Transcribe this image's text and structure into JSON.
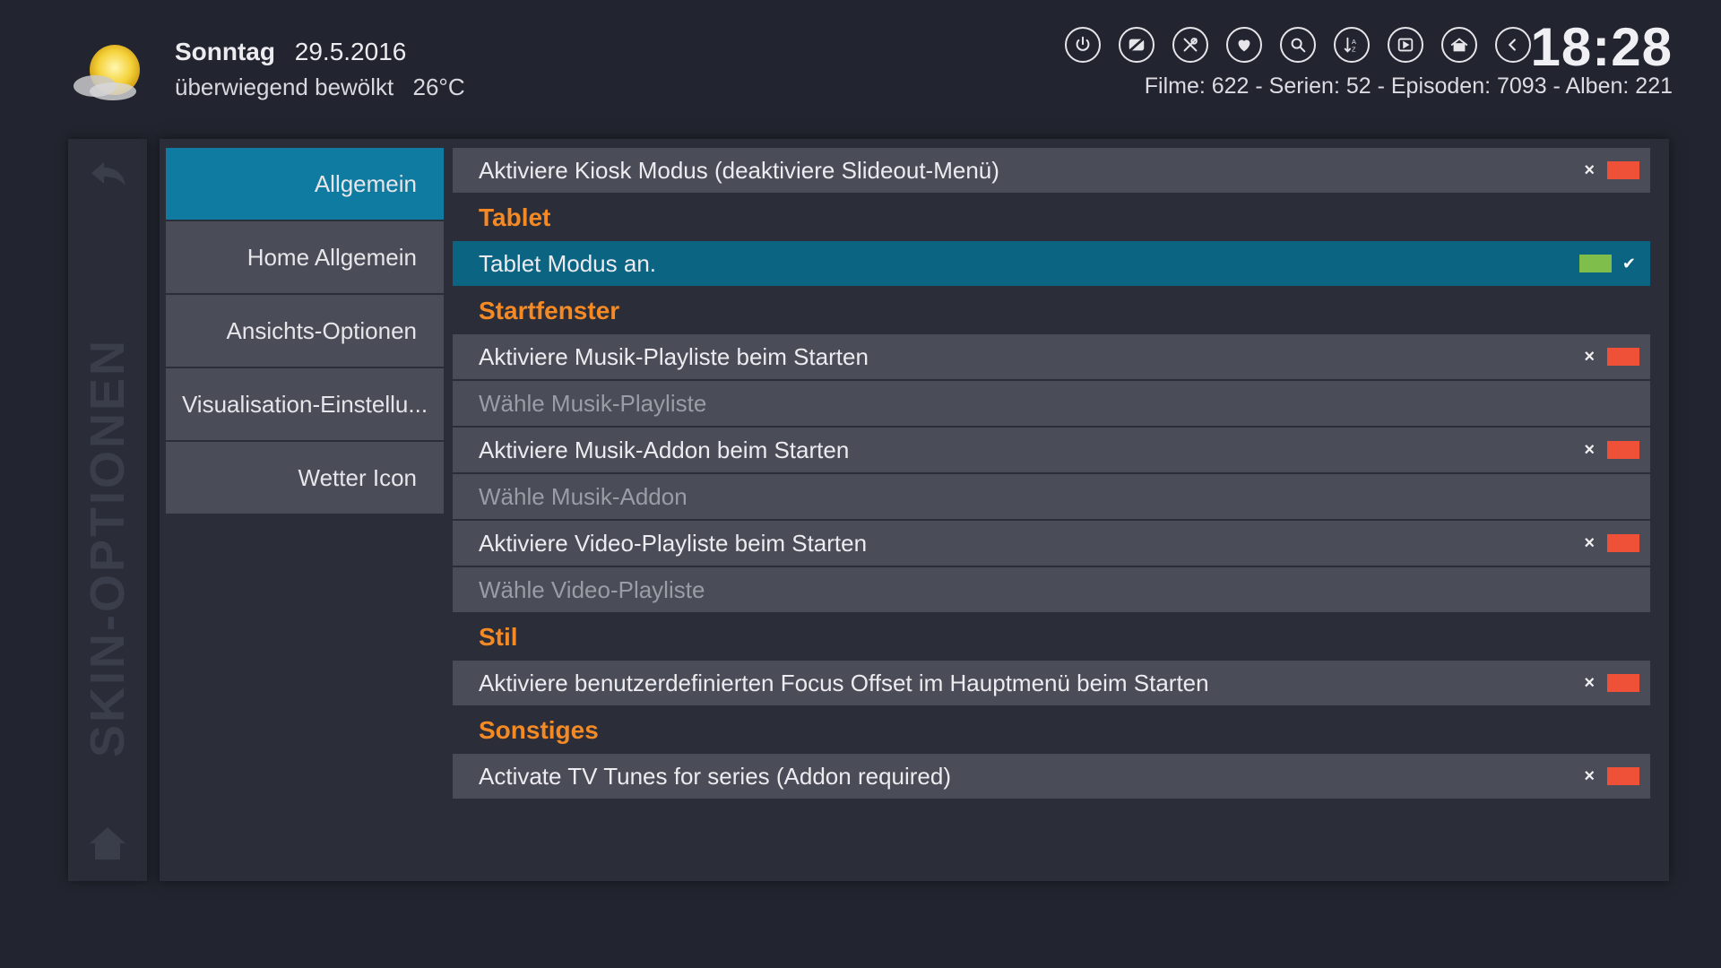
{
  "weather": {
    "day": "Sonntag",
    "date": "29.5.2016",
    "condition": "überwiegend bewölkt",
    "temperature": "26°C",
    "icon": "partly-cloudy-sun-icon"
  },
  "clock": "18:28",
  "stats": "Filme: 622 - Serien: 52 - Episoden: 7093 - Alben: 221",
  "top_buttons": [
    {
      "name": "power-icon"
    },
    {
      "name": "no-video-icon"
    },
    {
      "name": "tools-icon"
    },
    {
      "name": "favorites-heart-icon"
    },
    {
      "name": "search-icon"
    },
    {
      "name": "sort-az-icon"
    },
    {
      "name": "media-icon"
    },
    {
      "name": "home-icon"
    },
    {
      "name": "back-icon"
    }
  ],
  "side_label": "SKIN-OPTIONEN",
  "categories": [
    {
      "label": "Allgemein"
    },
    {
      "label": "Home Allgemein"
    },
    {
      "label": "Ansichts-Optionen"
    },
    {
      "label": "Visualisation-Einstellu..."
    },
    {
      "label": "Wetter Icon"
    }
  ],
  "settings": {
    "kiosk": "Aktiviere Kiosk Modus (deaktiviere Slideout-Menü)",
    "tablet_header": "Tablet",
    "tablet_mode": "Tablet Modus an.",
    "start_header": "Startfenster",
    "music_playlist_enable": "Aktiviere Musik-Playliste beim Starten",
    "music_playlist_choose": "Wähle Musik-Playliste",
    "music_addon_enable": "Aktiviere Musik-Addon beim Starten",
    "music_addon_choose": "Wähle Musik-Addon",
    "video_playlist_enable": "Aktiviere Video-Playliste beim Starten",
    "video_playlist_choose": "Wähle Video-Playliste",
    "style_header": "Stil",
    "focus_offset": "Aktiviere benutzerdefinierten Focus Offset im Hauptmenü beim Starten",
    "misc_header": "Sonstiges",
    "tv_tunes": "Activate TV Tunes for series (Addon required)"
  },
  "symbols": {
    "off": "×",
    "on": "✔"
  },
  "colors": {
    "accent": "#0f7ba0",
    "header": "#f58a25",
    "toggle_off": "#ee5138",
    "toggle_on": "#7fbe4a"
  }
}
